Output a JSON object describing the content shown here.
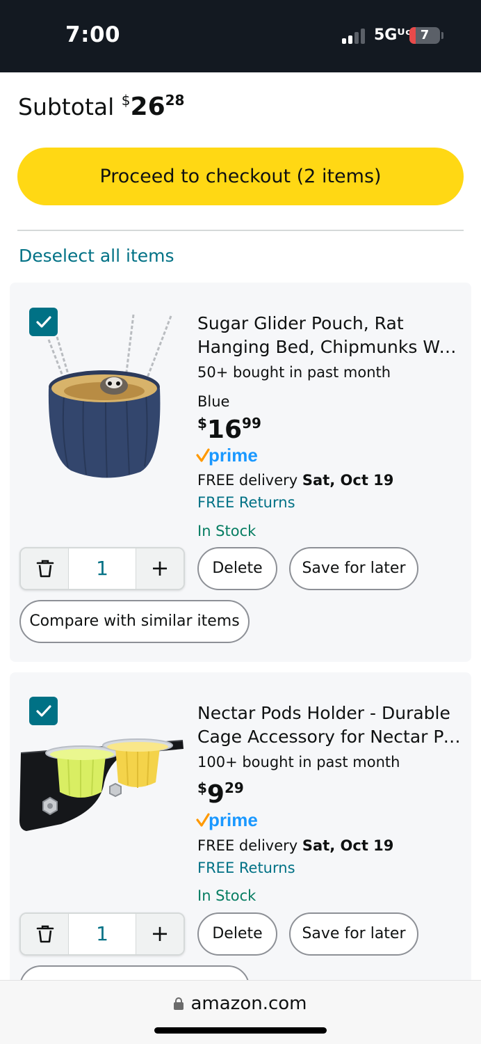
{
  "status_bar": {
    "time": "7:00",
    "network": "5Gᵁᶜ",
    "battery": "7",
    "battery_level": 0.07
  },
  "cart": {
    "subtotal_label": "Subtotal",
    "subtotal_currency": "$",
    "subtotal_whole": "26",
    "subtotal_fraction": "28",
    "checkout_label": "Proceed to checkout (2 items)",
    "deselect_label": "Deselect all items"
  },
  "items": [
    {
      "title_line1": "Sugar Glider Pouch, Rat",
      "title_line2": "Hanging Bed, Chipmunks Wa…",
      "bought": "50+ bought in past month",
      "variant": "Blue",
      "price_currency": "$",
      "price_whole": "16",
      "price_fraction": "99",
      "prime": "prime",
      "delivery_prefix": "FREE delivery",
      "delivery_date": "Sat, Oct 19",
      "returns": "FREE Returns",
      "stock": "In Stock",
      "quantity": "1",
      "delete_label": "Delete",
      "save_label": "Save for later",
      "compare_label": "Compare with similar items",
      "checked": true
    },
    {
      "title_line1": "Nectar Pods Holder - Durable",
      "title_line2": "Cage Accessory for Nectar Po…",
      "bought": "100+ bought in past month",
      "price_currency": "$",
      "price_whole": "9",
      "price_fraction": "29",
      "prime": "prime",
      "delivery_prefix": "FREE delivery",
      "delivery_date": "Sat, Oct 19",
      "returns": "FREE Returns",
      "stock": "In Stock",
      "quantity": "1",
      "delete_label": "Delete",
      "save_label": "Save for later",
      "checked": true
    }
  ],
  "browser": {
    "url": "amazon.com"
  },
  "colors": {
    "header": "#131921",
    "checkout": "#ffd814",
    "link": "#007185",
    "stock": "#067d62",
    "prime_check": "#ff9900",
    "prime_word": "#1a98ff"
  }
}
